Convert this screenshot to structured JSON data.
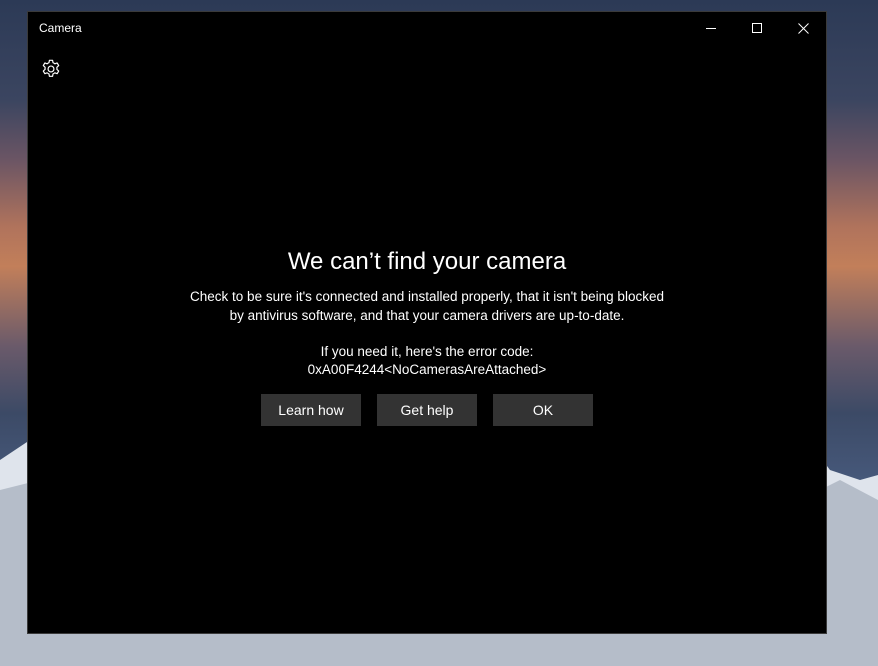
{
  "window": {
    "title": "Camera"
  },
  "icons": {
    "settings": "gear-icon",
    "minimize": "minimize-icon",
    "maximize": "maximize-icon",
    "close": "close-icon"
  },
  "error": {
    "heading": "We can’t find your camera",
    "line1": "Check to be sure it's connected and installed properly, that it isn't being blocked",
    "line2": "by antivirus software, and that your camera drivers are up-to-date.",
    "code_label": "If you need it, here's the error code:",
    "code": "0xA00F4244<NoCamerasAreAttached>"
  },
  "buttons": {
    "learn_how": "Learn how",
    "get_help": "Get help",
    "ok": "OK"
  },
  "colors": {
    "window_bg": "#000000",
    "button_bg": "#333333",
    "text": "#ffffff"
  }
}
